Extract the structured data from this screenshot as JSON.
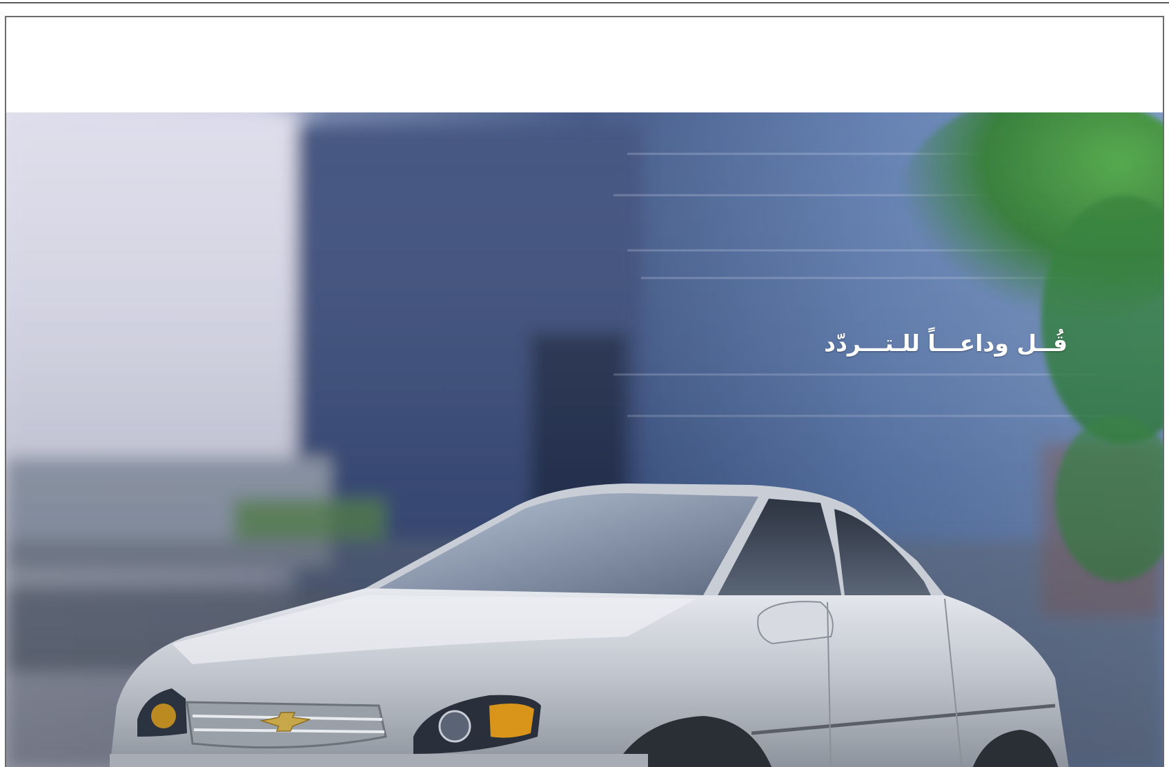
{
  "ad": {
    "headline": "قُــل وداعـــاً للـتـــردّد",
    "brand_emblem": "chevrolet-bowtie"
  },
  "colors": {
    "sky_left": "#d7d7e6",
    "building_blue": "#4b6594",
    "palm_green": "#3d8a3a",
    "car_silver": "#c3c7ce",
    "headlight_amber": "#d59a1c",
    "emblem_gold": "#c8a64a"
  }
}
